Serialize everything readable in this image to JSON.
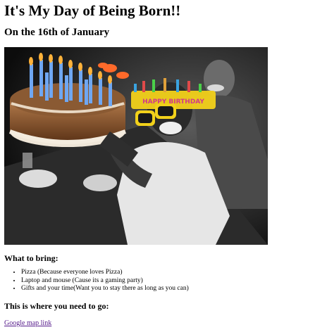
{
  "page": {
    "title": "It's My Day of Being Born!!",
    "date_line": "On the 16th of January"
  },
  "photo": {
    "description_icon": "birthday-party-photo",
    "glasses_text": "HAPPY BIRTHDAY",
    "accent_color": "#f2d11a"
  },
  "bring": {
    "heading": "What to bring:",
    "items": [
      "Pizza (Because everyone loves Pizza)",
      "Laptop and mouse (Cause its a gaming party)",
      "Gifts and your time(Want you to stay there as long as you can)"
    ]
  },
  "location": {
    "heading": "This is where you need to go:",
    "link_label": "Google map link"
  }
}
